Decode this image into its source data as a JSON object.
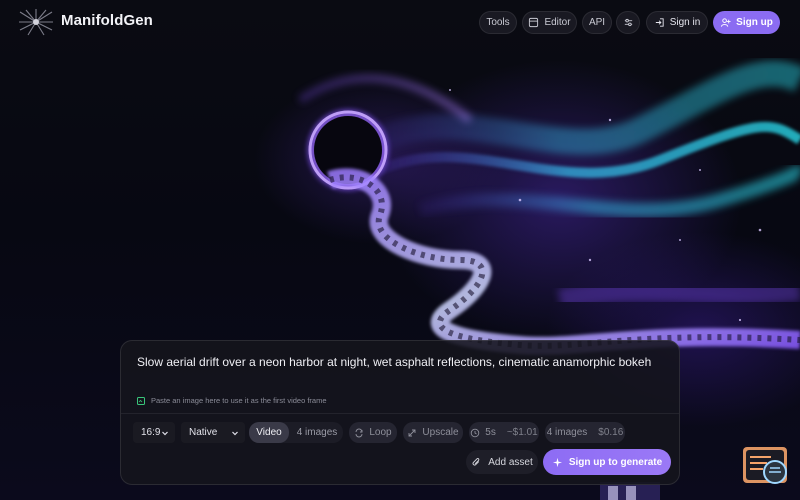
{
  "app": {
    "brand": "ManifoldGen"
  },
  "header": {
    "nav": [
      {
        "label": "Tools",
        "icon": "none"
      },
      {
        "label": "Editor",
        "icon": "editor-icon"
      },
      {
        "label": "API",
        "icon": "none"
      }
    ],
    "settings_icon": "sliders-icon",
    "signin_label": "Sign in",
    "signup_label": "Sign up"
  },
  "composer": {
    "prompt": "Slow aerial drift over a neon harbor at night, wet asphalt reflections, cinematic anamorphic bokeh",
    "paste_hint": "Paste an image here to use it as the first video frame",
    "aspect_ratio": "16:9",
    "resolution": "Native",
    "mode_tabs": [
      "Video",
      "4 images"
    ],
    "active_mode": "Video",
    "loop_label": "Loop",
    "upscale_label": "Upscale",
    "video_cost": {
      "duration": "5s",
      "price": "~$1.01"
    },
    "image_cost": {
      "count": "4 images",
      "price": "$0.16"
    },
    "add_asset_label": "Add asset",
    "generate_label": "Sign up to generate"
  },
  "colors": {
    "accent": "#8b6cf2",
    "background": "#05060c",
    "panel": "#14141c"
  }
}
